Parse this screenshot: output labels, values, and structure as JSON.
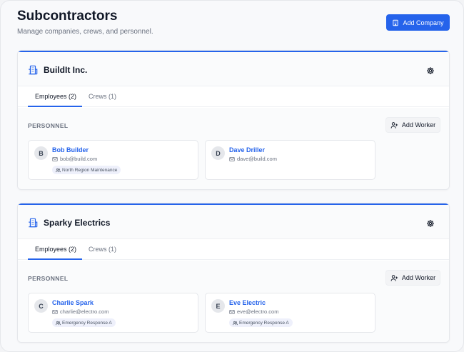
{
  "header": {
    "title": "Subcontractors",
    "subtitle": "Manage companies, crews, and personnel.",
    "add_company_label": "Add Company"
  },
  "colors": {
    "accent": "#2563eb",
    "link": "#2563eb"
  },
  "companies": [
    {
      "name": "BuildIt Inc.",
      "tabs": [
        "Employees (2)",
        "Crews (1)"
      ],
      "active_tab": "Employees (2)",
      "section_label": "PERSONNEL",
      "add_worker_label": "Add Worker",
      "workers": [
        {
          "initial": "B",
          "name": "Bob Builder",
          "email": "bob@build.com",
          "crew": "North Region Maintenance"
        },
        {
          "initial": "D",
          "name": "Dave Driller",
          "email": "dave@build.com",
          "crew": ""
        }
      ]
    },
    {
      "name": "Sparky Electrics",
      "tabs": [
        "Employees (2)",
        "Crews (1)"
      ],
      "active_tab": "Employees (2)",
      "section_label": "PERSONNEL",
      "add_worker_label": "Add Worker",
      "workers": [
        {
          "initial": "C",
          "name": "Charlie Spark",
          "email": "charlie@electro.com",
          "crew": "Emergency Response A"
        },
        {
          "initial": "E",
          "name": "Eve Electric",
          "email": "eve@electro.com",
          "crew": "Emergency Response A"
        }
      ]
    }
  ],
  "icons": [
    "building-icon",
    "gear-icon",
    "user-plus-icon",
    "mail-icon",
    "crew-icon"
  ]
}
